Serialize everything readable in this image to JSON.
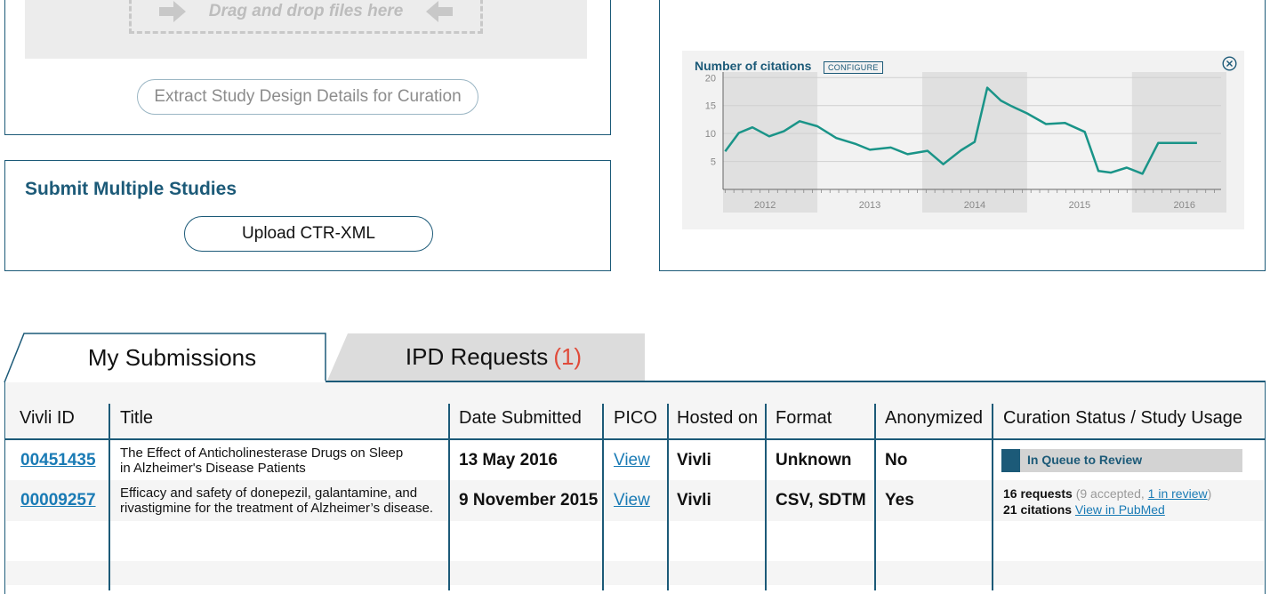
{
  "upload": {
    "drop_text": "Drag and drop files here",
    "extract_label": "Extract Study Design Details for Curation"
  },
  "multi": {
    "title": "Submit Multiple Studies",
    "upload_label": "Upload CTR-XML"
  },
  "chart": {
    "title": "Number of citations",
    "configure_label": "CONFIGURE",
    "close_icon": "close-circle-icon",
    "line_color": "#1a9488",
    "shade_color": "#e0e0e0"
  },
  "chart_data": {
    "type": "line",
    "title": "Number of citations",
    "xlabel": "",
    "ylabel": "",
    "x_ticks": [
      "2012",
      "2013",
      "2014",
      "2015",
      "2016"
    ],
    "y_ticks": [
      5,
      10,
      15,
      20
    ],
    "ylim": [
      0,
      21
    ],
    "xlim": [
      2011.6,
      2016.35
    ],
    "grid": true,
    "shaded_years": [
      "2012",
      "2014",
      "2016"
    ],
    "series": [
      {
        "x": [
          2011.62,
          2011.75,
          2011.88,
          2012.04,
          2012.18,
          2012.33,
          2012.5,
          2012.68,
          2012.87,
          2013.0,
          2013.2,
          2013.36,
          2013.55,
          2013.7,
          2013.87,
          2014.0,
          2014.12,
          2014.25,
          2014.35,
          2014.5,
          2014.68,
          2014.86,
          2015.05,
          2015.18,
          2015.3,
          2015.45,
          2015.6,
          2015.75,
          2015.9,
          2016.02,
          2016.12
        ],
        "values": [
          6.8,
          10.1,
          11.1,
          9.5,
          10.4,
          12.2,
          11.3,
          9.2,
          8.1,
          7.1,
          7.5,
          6.3,
          6.9,
          4.5,
          7.0,
          8.5,
          18.2,
          15.9,
          14.9,
          13.6,
          11.7,
          11.9,
          10.3,
          3.3,
          3.0,
          3.9,
          2.8,
          8.3,
          8.3,
          8.3,
          8.3
        ]
      }
    ]
  },
  "tabs": {
    "submissions_label": "My Submissions",
    "ipd_label": "IPD Requests",
    "ipd_count": "(1)"
  },
  "table": {
    "headers": [
      "Vivli ID",
      "Title",
      "Date Submitted",
      "PICO",
      "Hosted on",
      "Format",
      "Anonymized",
      "Curation Status / Study Usage"
    ],
    "rows": [
      {
        "id": "00451435",
        "title_line1": "The Effect of Anticholinesterase Drugs on Sleep",
        "title_line2": "in Alzheimer's Disease Patients",
        "date": "13 May 2016",
        "pico": "View",
        "hosted": "Vivli",
        "format": "Unknown",
        "anonymized": "No",
        "status": "In Queue to Review"
      },
      {
        "id": "00009257",
        "title_line1": "Efficacy and safety of donepezil, galantamine, and",
        "title_line2": "rivastigmine for the treatment of Alzheimer’s disease.",
        "date": "9 November 2015",
        "pico": "View",
        "hosted": "Vivli",
        "format": "CSV, SDTM",
        "anonymized": "Yes",
        "usage_requests": "16 requests",
        "usage_accepted": "(9 accepted,",
        "usage_in_review": "1 in review",
        "usage_close": ")",
        "usage_citations": "21 citations",
        "usage_pubmed": "View in PubMed"
      }
    ]
  }
}
